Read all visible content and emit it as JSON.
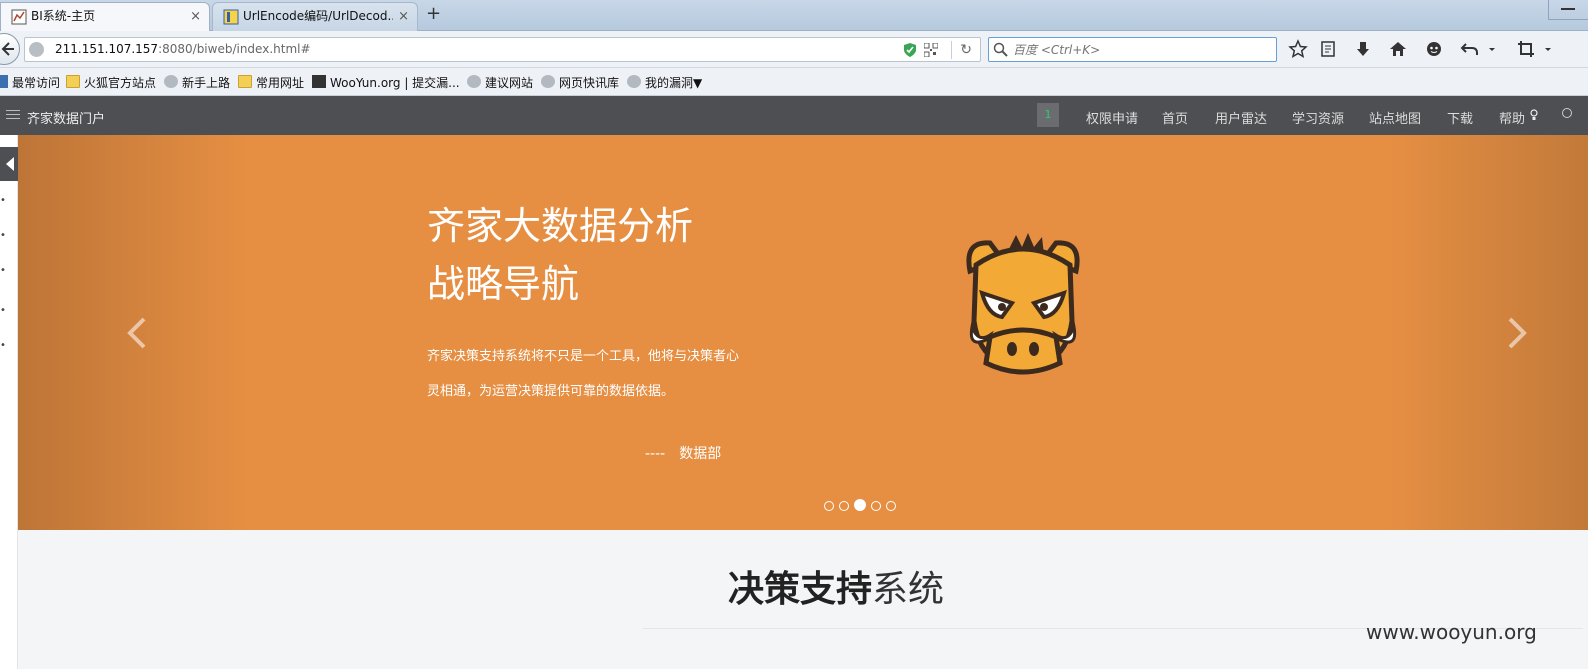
{
  "browser": {
    "tabs": [
      {
        "title": "BI系统-主页",
        "active": true
      },
      {
        "title": "UrlEncode编码/UrlDecod...",
        "active": false
      }
    ],
    "close_glyph": "×",
    "new_tab_glyph": "+",
    "url_host": "211.151.107.157",
    "url_rest": ":8080/biweb/index.html#",
    "search_placeholder": "百度 <Ctrl+K>",
    "reload_glyph": "↻"
  },
  "bookmarks": [
    {
      "label": "最常访问",
      "icon": "blue"
    },
    {
      "label": "火狐官方站点",
      "icon": "folder"
    },
    {
      "label": "新手上路",
      "icon": "globe"
    },
    {
      "label": "常用网址",
      "icon": "folder"
    },
    {
      "label": "WooYun.org | 提交漏...",
      "icon": "dark"
    },
    {
      "label": "建议网站",
      "icon": "globe"
    },
    {
      "label": "网页快讯库",
      "icon": "globe"
    },
    {
      "label": "我的漏洞▼",
      "icon": "globe"
    }
  ],
  "site": {
    "title": "齐家数据门户",
    "badge": "1",
    "nav": [
      "权限申请",
      "首页",
      "用户雷达",
      "学习资源",
      "站点地图",
      "下载",
      "帮助"
    ]
  },
  "hero": {
    "title": "齐家大数据分析\n战略导航",
    "description": "齐家决策支持系统将不只是一个工具，他将与决策者心灵相通，为运营决策提供可靠的数据依据。",
    "sign_dash": "----",
    "sign": "数据部",
    "slide_count": 5,
    "active_slide": 3,
    "background_color": "#e68f43"
  },
  "section": {
    "title_bold": "决策支持",
    "title_rest": "系统"
  },
  "watermark": "www.wooyun.org",
  "colors": {
    "header_bg": "#4d4f53",
    "badge_text": "#2ecc71"
  }
}
